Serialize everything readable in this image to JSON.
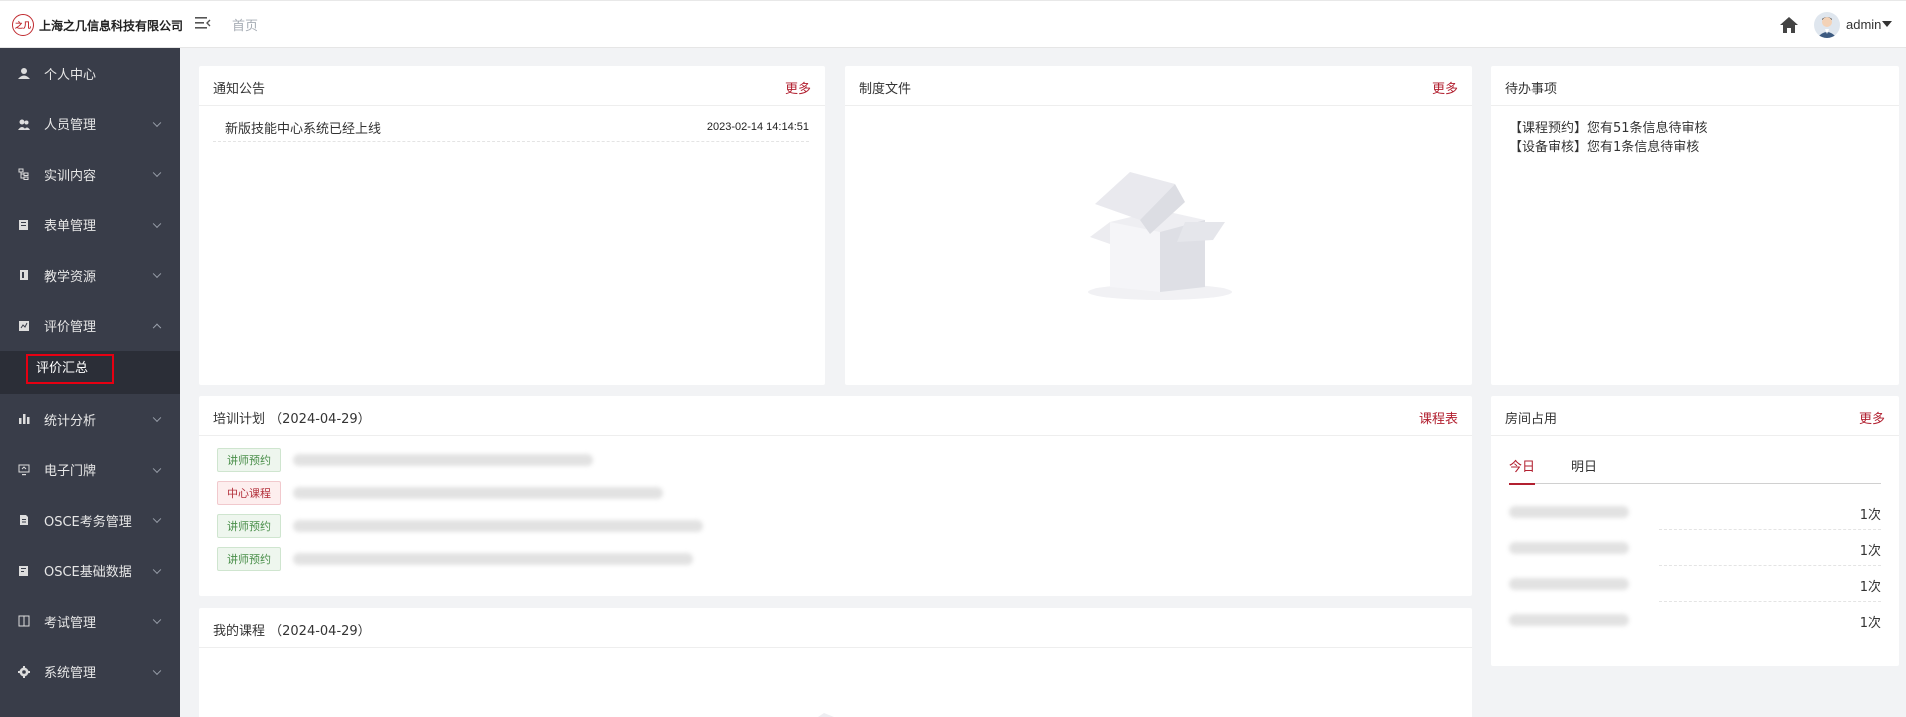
{
  "header": {
    "company": "上海之几信息科技有限公司",
    "logo_mark": "之几",
    "breadcrumb": "首页",
    "user": "admin"
  },
  "sidebar": {
    "items": [
      {
        "label": "个人中心",
        "icon": "user-icon"
      },
      {
        "label": "人员管理",
        "icon": "users-icon"
      },
      {
        "label": "实训内容",
        "icon": "tree-icon"
      },
      {
        "label": "表单管理",
        "icon": "form-icon"
      },
      {
        "label": "教学资源",
        "icon": "book-icon"
      },
      {
        "label": "评价管理",
        "icon": "evaluate-icon"
      },
      {
        "label": "统计分析",
        "icon": "bar-chart-icon"
      },
      {
        "label": "电子门牌",
        "icon": "monitor-icon"
      },
      {
        "label": "OSCE考务管理",
        "icon": "doc-icon"
      },
      {
        "label": "OSCE基础数据",
        "icon": "data-icon"
      },
      {
        "label": "考试管理",
        "icon": "exam-icon"
      },
      {
        "label": "系统管理",
        "icon": "gear-icon"
      }
    ],
    "sub_item": "评价汇总"
  },
  "notice": {
    "title": "通知公告",
    "more": "更多",
    "items": [
      {
        "title": "新版技能中心系统已经上线",
        "date": "2023-02-14 14:14:51"
      }
    ]
  },
  "policy": {
    "title": "制度文件",
    "more": "更多"
  },
  "todo": {
    "title": "待办事项",
    "lines": [
      "【课程预约】您有51条信息待审核",
      "【设备审核】您有1条信息待审核"
    ]
  },
  "plan": {
    "title": "培训计划 （2024-04-29）",
    "link": "课程表",
    "tags": [
      "讲师预约",
      "中心课程",
      "讲师预约",
      "讲师预约"
    ]
  },
  "my_course": {
    "title": "我的课程 （2024-04-29）"
  },
  "room": {
    "title": "房间占用",
    "more": "更多",
    "tabs": [
      "今日",
      "明日"
    ],
    "counts": [
      "1次",
      "1次",
      "1次",
      "1次"
    ]
  },
  "colors": {
    "accent": "#b22030",
    "sidebar_bg": "#393d49",
    "highlight_border": "#e60012"
  }
}
